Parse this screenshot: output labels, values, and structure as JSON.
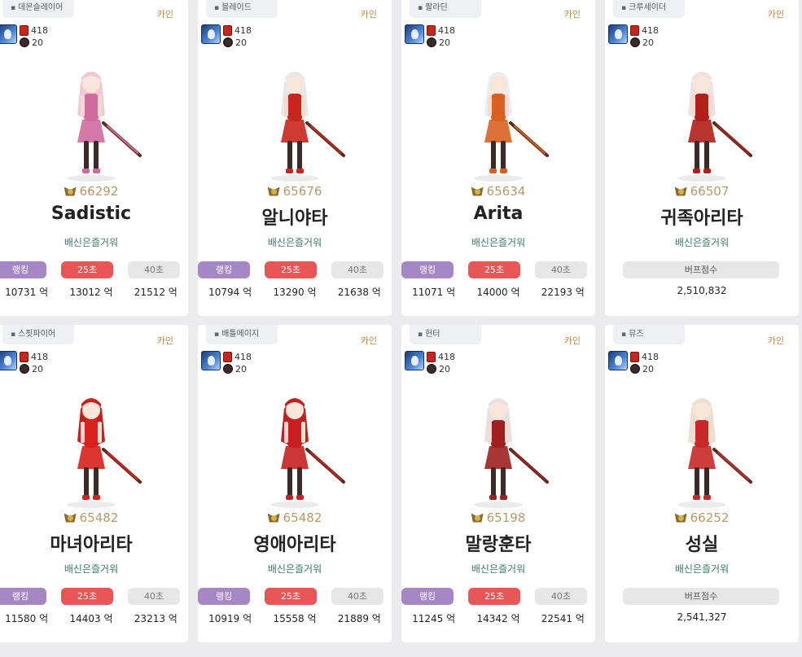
{
  "cards": [
    {
      "job": "데몬슬레이어",
      "server": "카인",
      "level": "418",
      "fame_sub": "20",
      "power": "66292",
      "name": "Sadistic",
      "guild": "배신은즐거워",
      "kind": "dealer",
      "rank_label": "랭킹",
      "s25_label": "25초",
      "s40_label": "40초",
      "values": [
        "10731 억",
        "13012 억",
        "21512 억"
      ],
      "accent": "#d06aa0"
    },
    {
      "job": "블레이드",
      "server": "카인",
      "level": "418",
      "fame_sub": "20",
      "power": "65676",
      "name": "알니야타",
      "guild": "배신은즐거워",
      "kind": "dealer",
      "rank_label": "랭킹",
      "s25_label": "25초",
      "s40_label": "40초",
      "values": [
        "10794 억",
        "13290 억",
        "21638 억"
      ],
      "accent": "#c8261c"
    },
    {
      "job": "팔라딘",
      "server": "카인",
      "level": "418",
      "fame_sub": "20",
      "power": "65634",
      "name": "Arita",
      "guild": "배신은즐거워",
      "kind": "dealer",
      "rank_label": "랭킹",
      "s25_label": "25초",
      "s40_label": "40초",
      "values": [
        "11071 억",
        "14000 억",
        "22193 억"
      ],
      "accent": "#d86020"
    },
    {
      "job": "크루세이더",
      "server": "카인",
      "level": "418",
      "fame_sub": "20",
      "power": "66507",
      "name": "귀족아리타",
      "guild": "배신은즐거워",
      "kind": "buffer",
      "buff_label": "버프점수",
      "buff_value": "2,510,832",
      "accent": "#b02018"
    },
    {
      "job": "스핏파이어",
      "server": "카인",
      "level": "418",
      "fame_sub": "20",
      "power": "65482",
      "name": "마녀아리타",
      "guild": "배신은즐거워",
      "kind": "dealer",
      "rank_label": "랭킹",
      "s25_label": "25초",
      "s40_label": "40초",
      "values": [
        "11580 억",
        "14403 억",
        "23213 억"
      ],
      "accent": "#d8201c"
    },
    {
      "job": "배틀메이지",
      "server": "카인",
      "level": "418",
      "fame_sub": "20",
      "power": "65482",
      "name": "영애아리타",
      "guild": "배신은즐거워",
      "kind": "dealer",
      "rank_label": "랭킹",
      "s25_label": "25초",
      "s40_label": "40초",
      "values": [
        "10919 억",
        "15558 억",
        "21889 억"
      ],
      "accent": "#c82020"
    },
    {
      "job": "헌터",
      "server": "카인",
      "level": "418",
      "fame_sub": "20",
      "power": "65198",
      "name": "말랑훈타",
      "guild": "배신은즐거워",
      "kind": "dealer",
      "rank_label": "랭킹",
      "s25_label": "25초",
      "s40_label": "40초",
      "values": [
        "11245 억",
        "14342 억",
        "22541 억"
      ],
      "accent": "#a02020"
    },
    {
      "job": "뮤즈",
      "server": "카인",
      "level": "418",
      "fame_sub": "20",
      "power": "66252",
      "name": "성실",
      "guild": "배신은즐거워",
      "kind": "buffer",
      "buff_label": "버프점수",
      "buff_value": "2,541,327",
      "accent": "#c82828"
    }
  ]
}
